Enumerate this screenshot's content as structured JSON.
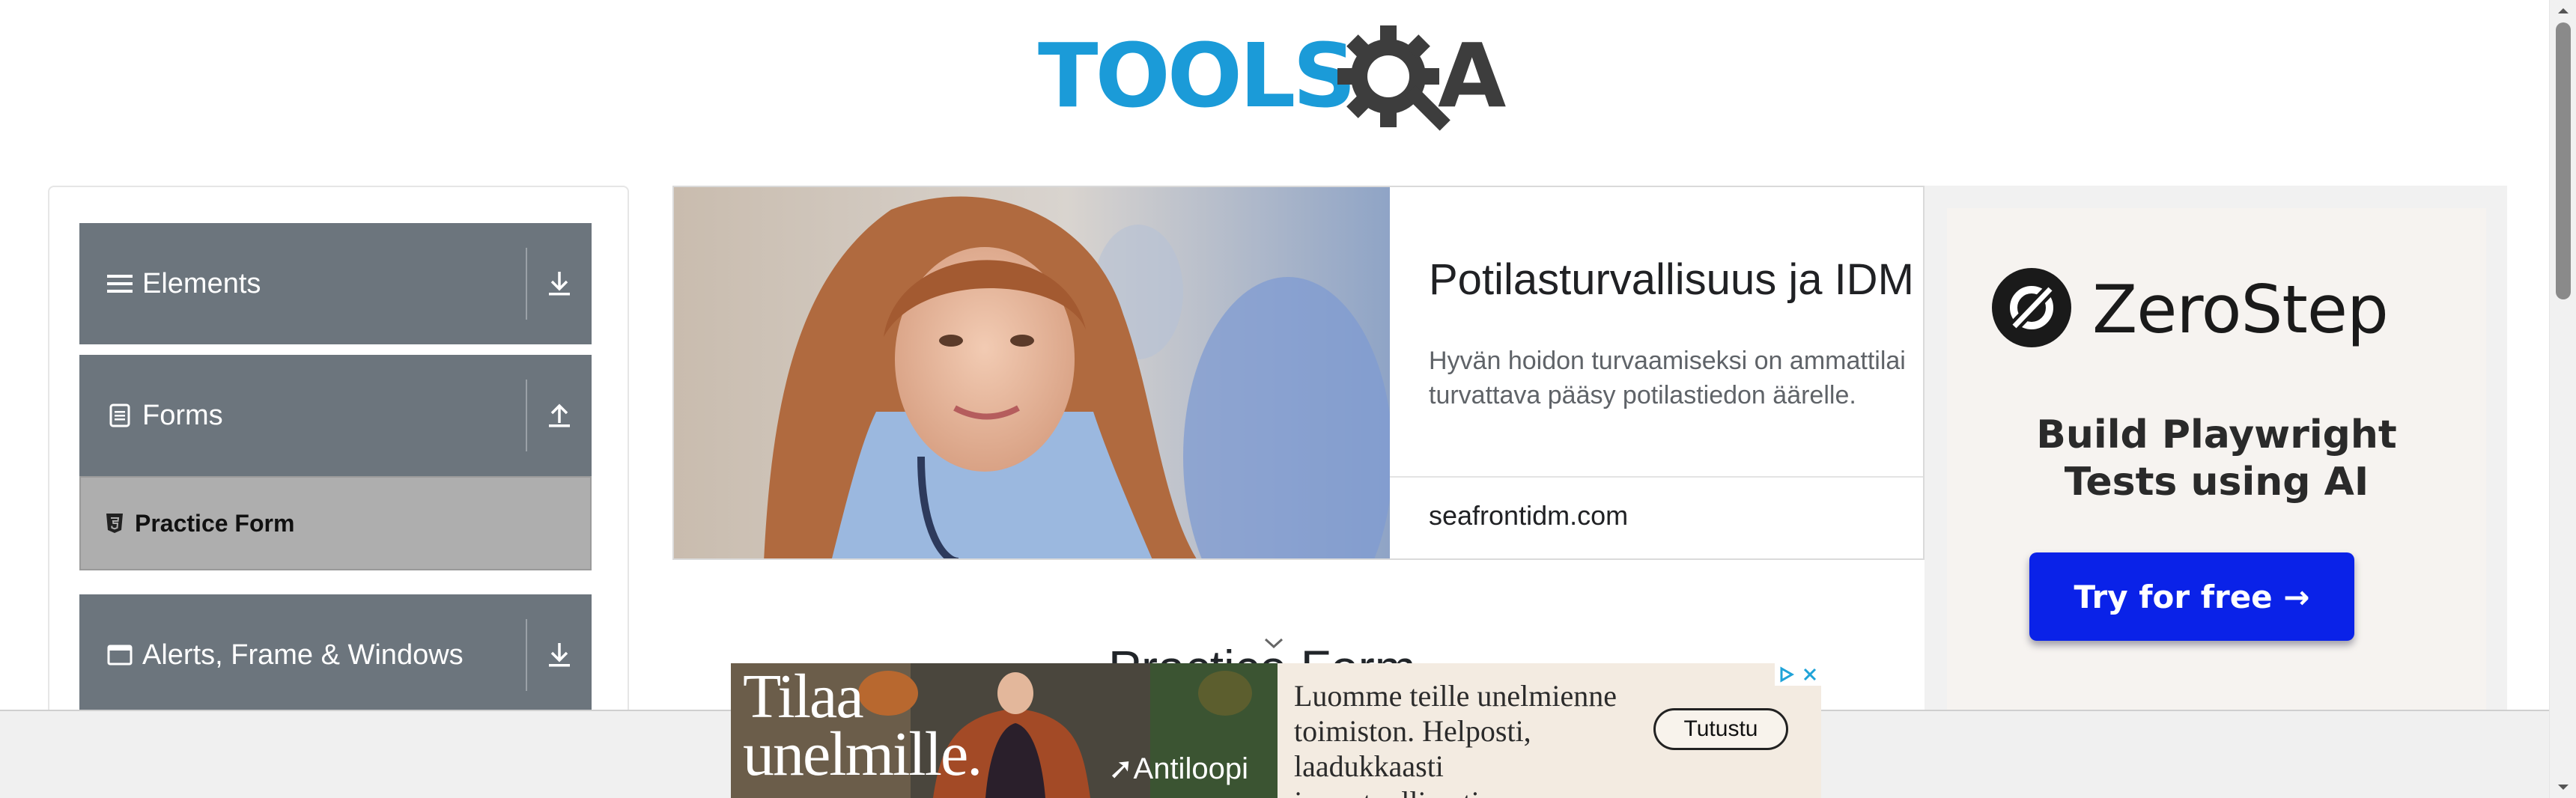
{
  "header": {
    "logo_text_left": "TOOLS",
    "logo_text_right": "QA"
  },
  "sidebar": {
    "groups": [
      {
        "label": "Elements",
        "icon": "hamburger-icon",
        "arrow": "download-arrow-icon"
      },
      {
        "label": "Forms",
        "icon": "document-icon",
        "arrow": "upload-arrow-icon",
        "items": [
          {
            "label": "Practice Form",
            "icon": "html5-icon",
            "active": true
          }
        ]
      },
      {
        "label": "Alerts, Frame & Windows",
        "icon": "window-icon",
        "arrow": "download-arrow-icon"
      }
    ]
  },
  "banner_ad": {
    "title": "Potilasturvallisuus ja IDM",
    "description": "Hyvän hoidon turvaamiseksi on ammattilai... turvattava pääsy potilastiedon äärelle.",
    "description_line1": "Hyvän hoidon turvaamiseksi on ammattilai",
    "description_line2": "turvattava pääsy potilastiedon äärelle.",
    "domain": "seafrontidm.com"
  },
  "side_ad": {
    "brand": "ZeroStep",
    "tagline_line1": "Build Playwright",
    "tagline_line2": "Tests using AI",
    "cta": "Try for free →"
  },
  "main": {
    "page_title": "Practice Form"
  },
  "bottom_ad": {
    "headline_line1": "Tilaa",
    "headline_line2": "unelmille.",
    "brand": "Antiloopi",
    "copy_line1": "Luomme teille unelmienne",
    "copy_line2": "toimiston. Helposti, laadukkaasti",
    "copy_line3": "ja vastuullisesti.",
    "button": "Tutustu"
  },
  "colors": {
    "logo_blue": "#1b9bd8",
    "logo_dark": "#3d3d3d",
    "menu_gray": "#6c757d",
    "active_item": "#aeaeae",
    "cta_blue": "#0a22e8"
  }
}
